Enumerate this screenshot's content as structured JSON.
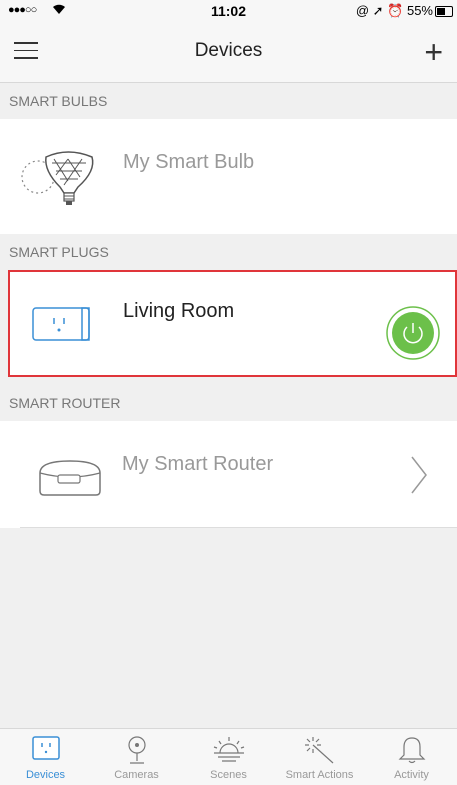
{
  "status_bar": {
    "signal": "●●●○○",
    "time": "11:02",
    "right_indicators": "@ ➚ ⏰ 55%"
  },
  "nav": {
    "title": "Devices",
    "menu_icon": "hamburger-icon",
    "add_icon": "plus-icon"
  },
  "sections": {
    "bulbs": {
      "header": "SMART BULBS",
      "device": "My Smart Bulb"
    },
    "plugs": {
      "header": "SMART PLUGS",
      "device": "Living Room",
      "power_state": "on"
    },
    "router": {
      "header": "SMART ROUTER",
      "device": "My Smart Router"
    }
  },
  "tabs": [
    {
      "label": "Devices",
      "icon": "plug-icon",
      "active": true
    },
    {
      "label": "Cameras",
      "icon": "camera-icon",
      "active": false
    },
    {
      "label": "Scenes",
      "icon": "sunrise-icon",
      "active": false
    },
    {
      "label": "Smart Actions",
      "icon": "magic-wand-icon",
      "active": false
    },
    {
      "label": "Activity",
      "icon": "bell-icon",
      "active": false
    }
  ],
  "colors": {
    "accent": "#3a8fd6",
    "power_on": "#6cc04a",
    "highlight_border": "#e0353a"
  }
}
